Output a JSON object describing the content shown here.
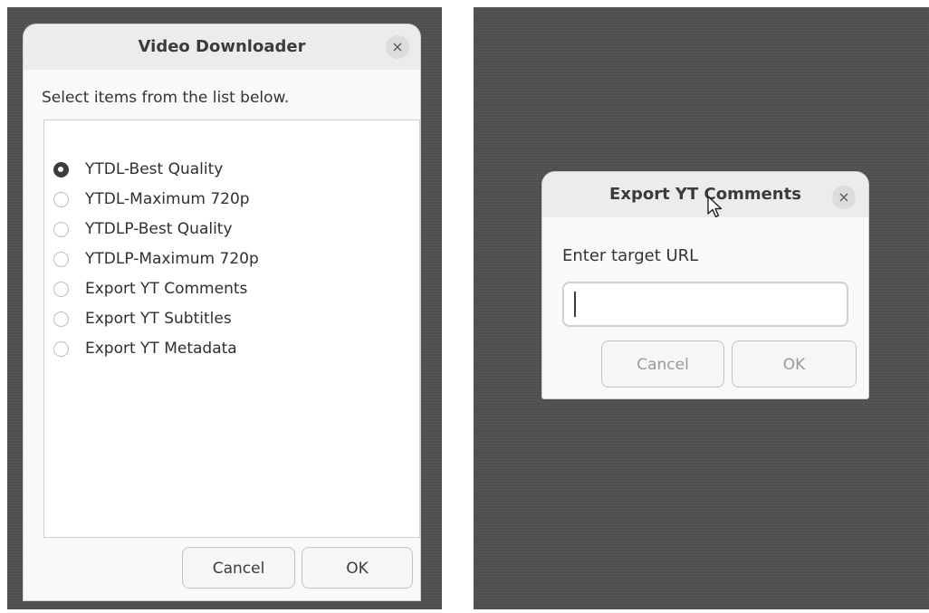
{
  "main_dialog": {
    "title": "Video Downloader",
    "close_icon": "×",
    "prompt": "Select items from the list below.",
    "options": [
      {
        "label": "YTDL-Best Quality",
        "selected": true
      },
      {
        "label": "YTDL-Maximum 720p",
        "selected": false
      },
      {
        "label": "YTDLP-Best Quality",
        "selected": false
      },
      {
        "label": "YTDLP-Maximum 720p",
        "selected": false
      },
      {
        "label": "Export YT Comments",
        "selected": false
      },
      {
        "label": "Export YT Subtitles",
        "selected": false
      },
      {
        "label": "Export YT Metadata",
        "selected": false
      }
    ],
    "cancel_label": "Cancel",
    "ok_label": "OK"
  },
  "export_dialog": {
    "title": "Export YT Comments",
    "close_icon": "×",
    "prompt": "Enter target URL",
    "url_value": "",
    "cancel_label": "Cancel",
    "ok_label": "OK"
  },
  "colors": {
    "backdrop": "#505050",
    "dialog_bg": "#f9f9f9",
    "titlebar_bg": "#ececec"
  },
  "icons": {
    "close": "close-icon",
    "pointer": "mouse-pointer-icon"
  }
}
